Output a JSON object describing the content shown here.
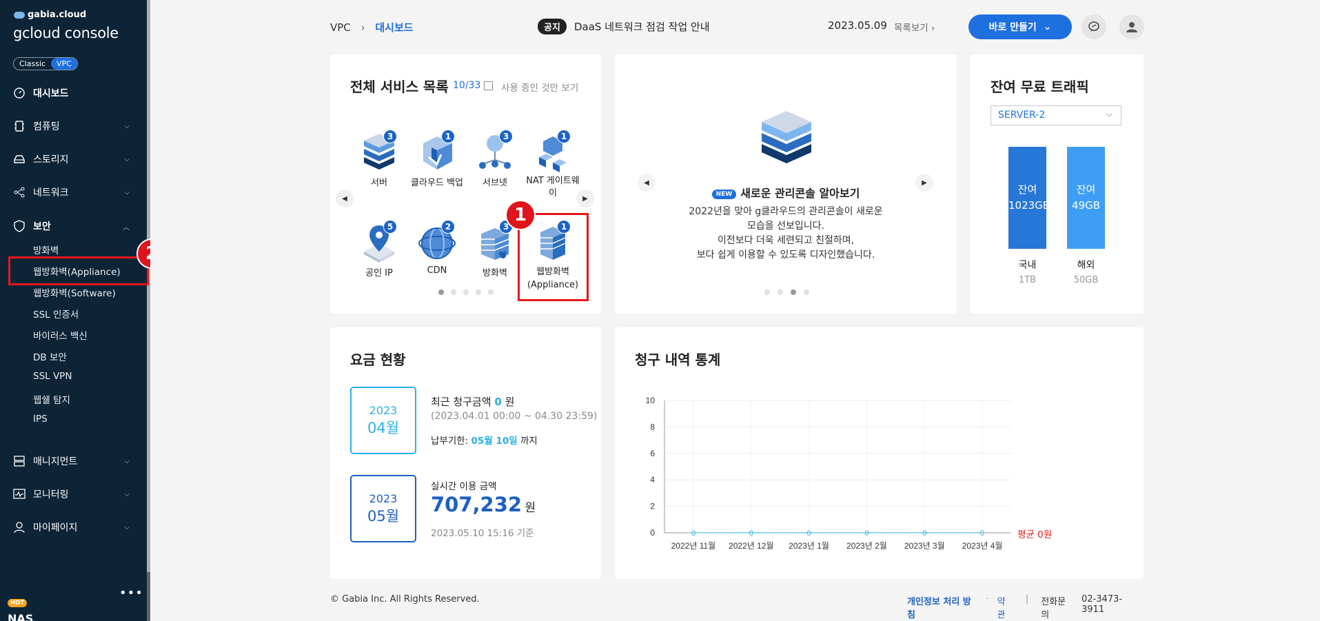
{
  "sidebar": {
    "brand": "gabia.cloud",
    "console": "gcloud console",
    "toggle": [
      "Classic",
      "VPC"
    ],
    "menu": [
      {
        "label": "대시보드",
        "icon": "dashboard-icon"
      },
      {
        "label": "컴퓨팅",
        "icon": "chip-icon"
      },
      {
        "label": "스토리지",
        "icon": "storage-icon"
      },
      {
        "label": "네트워크",
        "icon": "network-icon"
      },
      {
        "label": "보안",
        "icon": "shield-icon"
      }
    ],
    "security_sub": [
      "방화벽",
      "웹방화벽(Appliance)",
      "웹방화벽(Software)",
      "SSL 인증서",
      "바이러스 백신",
      "DB 보안",
      "SSL VPN",
      "웹쉘 탐지",
      "IPS"
    ],
    "menu_bottom": [
      {
        "label": "매니지먼트",
        "icon": "server-stack-icon"
      },
      {
        "label": "모니터링",
        "icon": "monitor-icon"
      },
      {
        "label": "마이페이지",
        "icon": "person-icon"
      }
    ],
    "more": "•••",
    "hot_badge": "HOT",
    "promo": "NAS",
    "step_badge": "2"
  },
  "topbar": {
    "crumb_root": "VPC",
    "crumb_sep": "›",
    "crumb_current": "대시보드",
    "notice_tag": "공지",
    "notice_text": "DaaS 네트워크 점검 작업 안내",
    "notice_date": "2023.05.09",
    "list_link": "목록보기",
    "create_button": "바로 만들기"
  },
  "services": {
    "title": "전체 서비스 목록",
    "count": "10/33",
    "filter_label": "사용 중인 것만 보기",
    "items": [
      {
        "label": "서버",
        "count": "3"
      },
      {
        "label": "클라우드 백업",
        "count": "1"
      },
      {
        "label": "서브넷",
        "count": "3"
      },
      {
        "label": "NAT 게이트웨이",
        "count": "1"
      },
      {
        "label": "공인 IP",
        "count": "5"
      },
      {
        "label": "CDN",
        "count": "2"
      },
      {
        "label": "방화벽",
        "count": "3"
      },
      {
        "label": "웹방화벽 (Appliance)",
        "count": "1"
      }
    ],
    "step_badge": "1"
  },
  "banner": {
    "new_tag": "NEW",
    "title": "새로운 관리콘솔 알아보기",
    "desc": [
      "2022년을 맞아 g클라우드의 관리콘솔이 새로운",
      "모습을 선보입니다.",
      "이전보다 더욱 세련되고 친절하며,",
      "보다 쉽게 이용할 수 있도록 디자인했습니다."
    ]
  },
  "traffic": {
    "title": "잔여 무료 트래픽",
    "selected_server": "SERVER-2",
    "bars": [
      {
        "top": "잔여",
        "value": "1023GB",
        "label": "국내",
        "total": "1TB",
        "color": "#2677d8"
      },
      {
        "top": "잔여",
        "value": "49GB",
        "label": "해외",
        "total": "50GB",
        "color": "#3e9ef5"
      }
    ]
  },
  "fee": {
    "title": "요금 현황",
    "recent": {
      "year": "2023",
      "month": "04월",
      "label_pre": "최근 청구금액",
      "amount": "0",
      "unit": "원",
      "period": "(2023.04.01 00:00 ~ 04.30 23:59)",
      "due_pre": "납부기한:",
      "due": "05월 10일",
      "due_post": "까지"
    },
    "realtime": {
      "year": "2023",
      "month": "05월",
      "label": "실시간 이용 금액",
      "amount": "707,232",
      "unit": "원",
      "asof": "2023.05.10 15:16 기준"
    }
  },
  "billing": {
    "title": "청구 내역 통계",
    "average": "평균 0원"
  },
  "chart_data": {
    "type": "line",
    "categories": [
      "2022년 11월",
      "2022년 12월",
      "2023년 1월",
      "2023년 2월",
      "2023년 3월",
      "2023년 4월"
    ],
    "values": [
      0,
      0,
      0,
      0,
      0,
      0
    ],
    "yticks": [
      0,
      2,
      4,
      6,
      8,
      10
    ],
    "ylim": [
      0,
      10
    ],
    "title": "",
    "xlabel": "",
    "ylabel": ""
  },
  "footer": {
    "copyright": "© Gabia Inc. All Rights Reserved.",
    "privacy": "개인정보 처리 방침",
    "dot": "·",
    "terms": "약관",
    "divider": "|",
    "contact_label": "전화문의",
    "phone": "02-3473-3911"
  },
  "colors": {
    "accent": "#1e6fe0",
    "sidebar": "#0d2437",
    "highlight": "#e6151a",
    "cyan": "#2ab0e6"
  }
}
